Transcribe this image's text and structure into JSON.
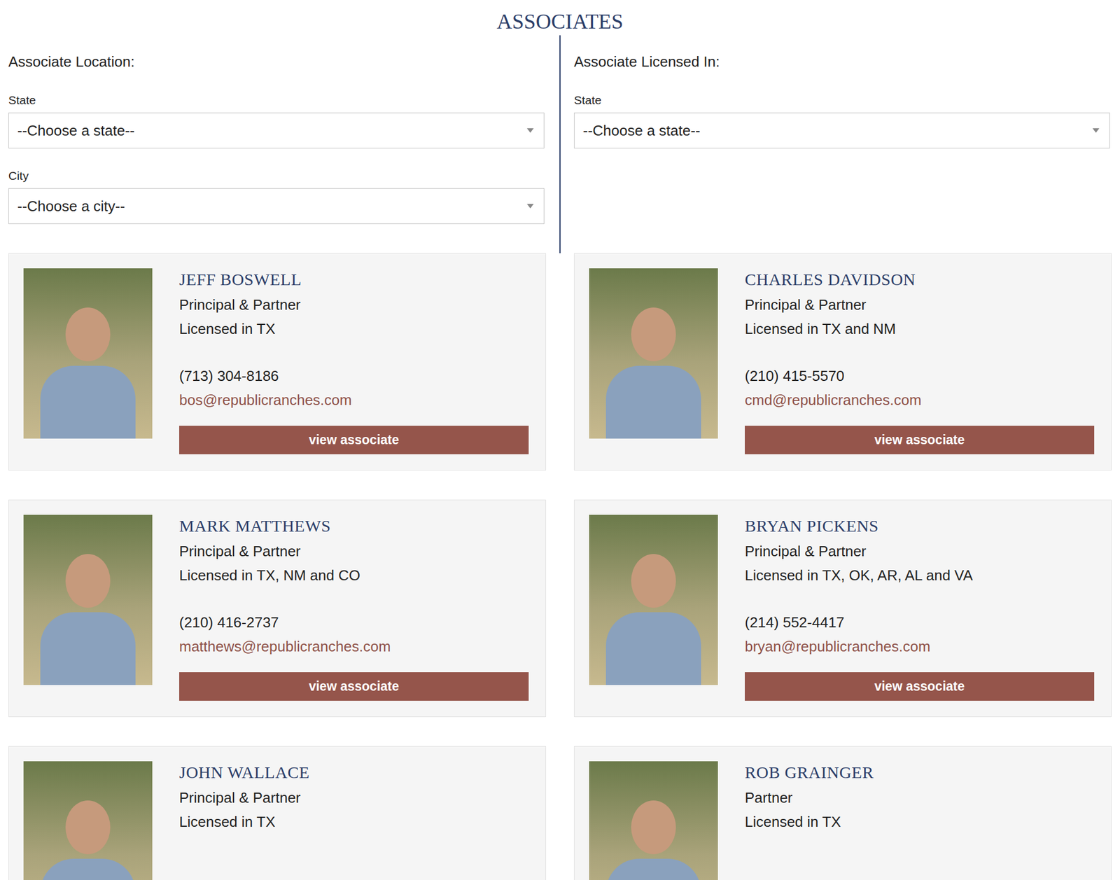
{
  "page": {
    "title": "ASSOCIATES"
  },
  "filters": {
    "location": {
      "heading": "Associate Location:",
      "fields": [
        {
          "label": "State",
          "placeholder": "--Choose a state--"
        },
        {
          "label": "City",
          "placeholder": "--Choose a city--"
        }
      ]
    },
    "licensed": {
      "heading": "Associate Licensed In:",
      "fields": [
        {
          "label": "State",
          "placeholder": "--Choose a state--"
        }
      ]
    }
  },
  "associates": [
    {
      "name": "JEFF BOSWELL",
      "role": "Principal & Partner",
      "licensed": "Licensed in TX",
      "phone": "(713) 304-8186",
      "email": "bos@republicranches.com",
      "button": "view associate"
    },
    {
      "name": "CHARLES DAVIDSON",
      "role": "Principal & Partner",
      "licensed": "Licensed in TX and NM",
      "phone": "(210) 415-5570",
      "email": "cmd@republicranches.com",
      "button": "view associate"
    },
    {
      "name": "MARK MATTHEWS",
      "role": "Principal & Partner",
      "licensed": "Licensed in TX, NM and CO",
      "phone": "(210) 416-2737",
      "email": "matthews@republicranches.com",
      "button": "view associate"
    },
    {
      "name": "BRYAN PICKENS",
      "role": "Principal & Partner",
      "licensed": "Licensed in TX, OK, AR, AL and VA",
      "phone": "(214) 552-4417",
      "email": "bryan@republicranches.com",
      "button": "view associate"
    },
    {
      "name": "JOHN WALLACE",
      "role": "Principal & Partner",
      "licensed": "Licensed in TX"
    },
    {
      "name": "ROB GRAINGER",
      "role": "Partner",
      "licensed": "Licensed in TX"
    }
  ]
}
